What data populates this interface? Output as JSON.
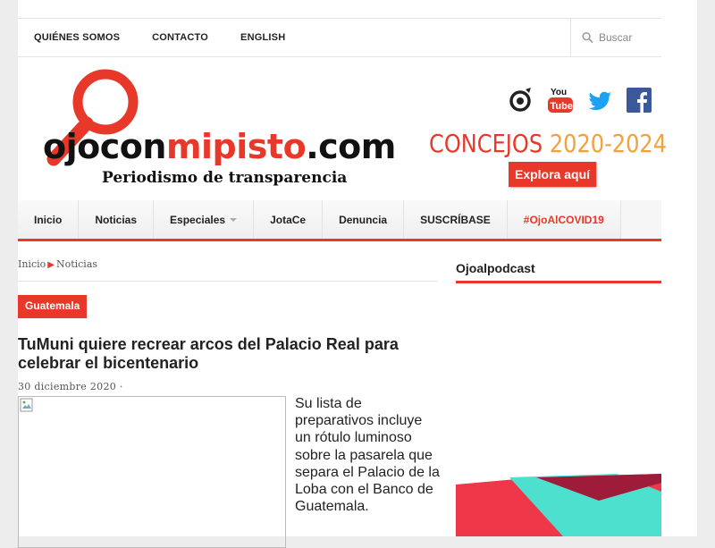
{
  "topnav": {
    "items": [
      "QUIÉNES SOMOS",
      "CONTACTO",
      "ENGLISH"
    ],
    "search_placeholder": "Buscar"
  },
  "logo": {
    "part1": "ojocon",
    "part2": "mipisto",
    "part3": ".com",
    "tagline": "Periodismo de transparencia"
  },
  "social": [
    "sostenible-icon",
    "youtube-icon",
    "twitter-icon",
    "facebook-icon"
  ],
  "banner": {
    "concejos": "CONCEJOS",
    "years": "2020-2024",
    "button": "Explora aquí"
  },
  "mainnav": {
    "items": [
      "Inicio",
      "Noticias",
      "Especiales",
      "JotaCe",
      "Denuncia",
      "SUSCRÍBASE",
      "#OjoAlCOVID19"
    ]
  },
  "breadcrumb": {
    "home": "Inicio",
    "current": "Noticias"
  },
  "article": {
    "category": "Guatemala",
    "title": "TuMuni quiere recrear arcos del Palacio Real para celebrar el bicentenario",
    "date": "30 diciembre 2020 ·",
    "excerpt": "Su lista de preparativos incluye un rótulo luminoso sobre la pasarela que separa el Palacio de la Loba con el Banco de Guatemala."
  },
  "sidebar": {
    "title": "Ojoalpodcast"
  },
  "colors": {
    "accent": "#e8382a",
    "years": "#f2a13b",
    "teal": "#4de0cf",
    "maroon": "#9e1b3a"
  }
}
